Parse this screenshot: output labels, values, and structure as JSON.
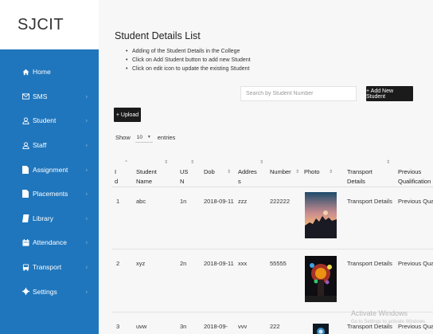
{
  "brand": "SJCIT",
  "sidebar": {
    "items": [
      {
        "label": "Home",
        "icon": "home-icon"
      },
      {
        "label": "SMS",
        "icon": "envelope-icon"
      },
      {
        "label": "Student",
        "icon": "user-icon"
      },
      {
        "label": "Staff",
        "icon": "user-icon"
      },
      {
        "label": "Assignment",
        "icon": "document-icon"
      },
      {
        "label": "Placements",
        "icon": "document-icon"
      },
      {
        "label": "Library",
        "icon": "book-icon"
      },
      {
        "label": "Attendance",
        "icon": "calendar-icon"
      },
      {
        "label": "Transport",
        "icon": "bus-icon"
      },
      {
        "label": "Settings",
        "icon": "gear-icon"
      }
    ],
    "chevron": "›"
  },
  "main": {
    "title": "Student Details List",
    "notes": [
      "Adding of the Student Details in the College",
      "Click on Add Student button to add new Student",
      "Click on edit icon to update the existing Student"
    ],
    "search_placeholder": "Search by Student Number",
    "add_button": "+ Add New Student",
    "upload_button": "+ Upload",
    "show_label": "Show",
    "entries_value": "10",
    "entries_label": "entries"
  },
  "table": {
    "columns": [
      "I\nd",
      "Student\nName",
      "US\nN",
      "Dob",
      "Addres\ns",
      "Number",
      "Photo",
      "Transport\nDetails",
      "Previous\nQualification"
    ],
    "rows": [
      {
        "id": "1",
        "name": "abc",
        "usn": "1n",
        "dob": "2018-09-11",
        "address": "zzz",
        "number": "222222",
        "transport": "Transport Details",
        "previous": "Previous Qualification"
      },
      {
        "id": "2",
        "name": "xyz",
        "usn": "2n",
        "dob": "2018-09-11",
        "address": "xxx",
        "number": "55555",
        "transport": "Transport Details",
        "previous": "Previous Qualification"
      },
      {
        "id": "3",
        "name": "uvw",
        "usn": "3n",
        "dob": "2018-09-",
        "address": "vvv",
        "number": "222",
        "transport": "Transport Details",
        "previous": "Previous Qualification"
      }
    ]
  },
  "watermark": {
    "title": "Activate Windows",
    "subtitle": "Go to Settings to activate Windows."
  },
  "colors": {
    "sidebar": "#1f76bd",
    "button": "#1b1b1b",
    "background": "#f7f7f7"
  }
}
